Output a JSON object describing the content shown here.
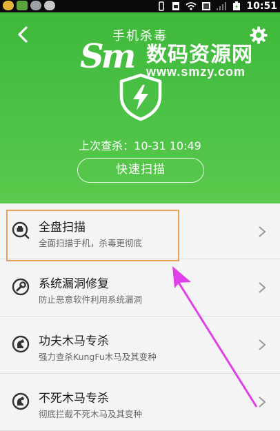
{
  "status_bar": {
    "time": "10:51",
    "icons": [
      "app-icon",
      "app-icon",
      "app-icon",
      "app-icon",
      "vibrate-icon",
      "sim-icon",
      "wifi-icon",
      "screenshot-icon",
      "signal-icon",
      "battery-icon"
    ]
  },
  "header": {
    "title": "手机杀毒",
    "last_scan": "上次查杀：10-31 10:49",
    "quick_scan_label": "快速扫描",
    "color": "#4cc247"
  },
  "watermark": {
    "cn": "数码资源网",
    "url": "www.smzy.com"
  },
  "list": [
    {
      "title": "全盘扫描",
      "subtitle": "全面扫描手机，杀毒更彻底",
      "icon": "full-scan-icon"
    },
    {
      "title": "系统漏洞修复",
      "subtitle": "防止恶意软件利用系统漏洞",
      "icon": "wrench-icon"
    },
    {
      "title": "功夫木马专杀",
      "subtitle": "强力查杀KungFu木马及其变种",
      "icon": "horse-icon"
    },
    {
      "title": "不死木马专杀",
      "subtitle": "彻底拦截不死木马及其变种",
      "icon": "horse-icon"
    }
  ],
  "annotation_colors": {
    "box": "#e8a25a",
    "arrow": "#e040e8"
  }
}
